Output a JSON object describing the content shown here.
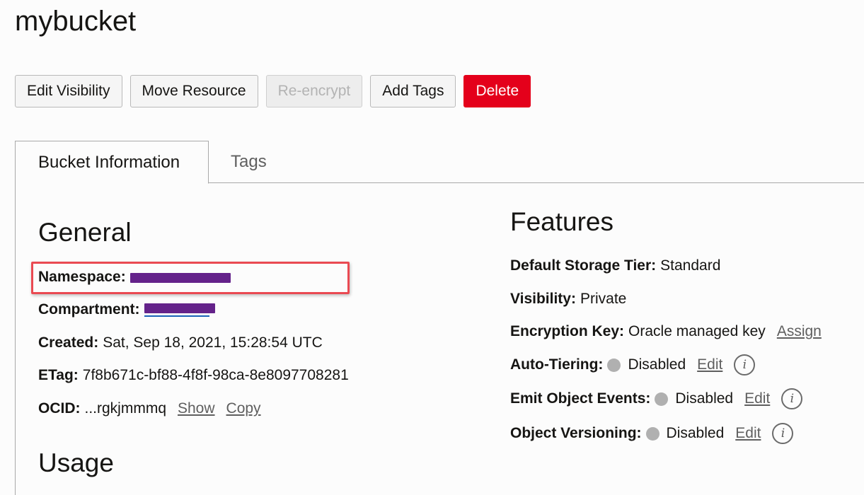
{
  "page": {
    "title": "mybucket"
  },
  "toolbar": {
    "buttons": [
      {
        "label": "Edit Visibility",
        "state": "enabled"
      },
      {
        "label": "Move Resource",
        "state": "enabled"
      },
      {
        "label": "Re-encrypt",
        "state": "disabled"
      },
      {
        "label": "Add Tags",
        "state": "enabled"
      },
      {
        "label": "Delete",
        "state": "danger"
      }
    ]
  },
  "tabs": [
    {
      "label": "Bucket Information",
      "active": true
    },
    {
      "label": "Tags",
      "active": false
    }
  ],
  "general": {
    "heading": "General",
    "namespace": {
      "label": "Namespace:",
      "value": "[redacted]"
    },
    "compartment": {
      "label": "Compartment:",
      "value": "[redacted]"
    },
    "created": {
      "label": "Created:",
      "value": "Sat, Sep 18, 2021, 15:28:54 UTC"
    },
    "etag": {
      "label": "ETag:",
      "value": "7f8b671c-bf88-4f8f-98ca-8e8097708281"
    },
    "ocid": {
      "label": "OCID:",
      "value": "...rgkjmmmq",
      "show_link": "Show",
      "copy_link": "Copy"
    }
  },
  "usage": {
    "heading": "Usage"
  },
  "features": {
    "heading": "Features",
    "default_storage_tier": {
      "label": "Default Storage Tier:",
      "value": "Standard"
    },
    "visibility": {
      "label": "Visibility:",
      "value": "Private"
    },
    "encryption_key": {
      "label": "Encryption Key:",
      "value": "Oracle managed key",
      "action": "Assign"
    },
    "auto_tiering": {
      "label": "Auto-Tiering:",
      "value": "Disabled",
      "action": "Edit"
    },
    "emit_object_events": {
      "label": "Emit Object Events:",
      "value": "Disabled",
      "action": "Edit"
    },
    "object_versioning": {
      "label": "Object Versioning:",
      "value": "Disabled",
      "action": "Edit"
    },
    "info_glyph": "i"
  },
  "colors": {
    "danger": "#e4001b",
    "highlight": "#ea4a52",
    "redaction": "#64228a",
    "status_disabled": "#b0b0b0"
  }
}
